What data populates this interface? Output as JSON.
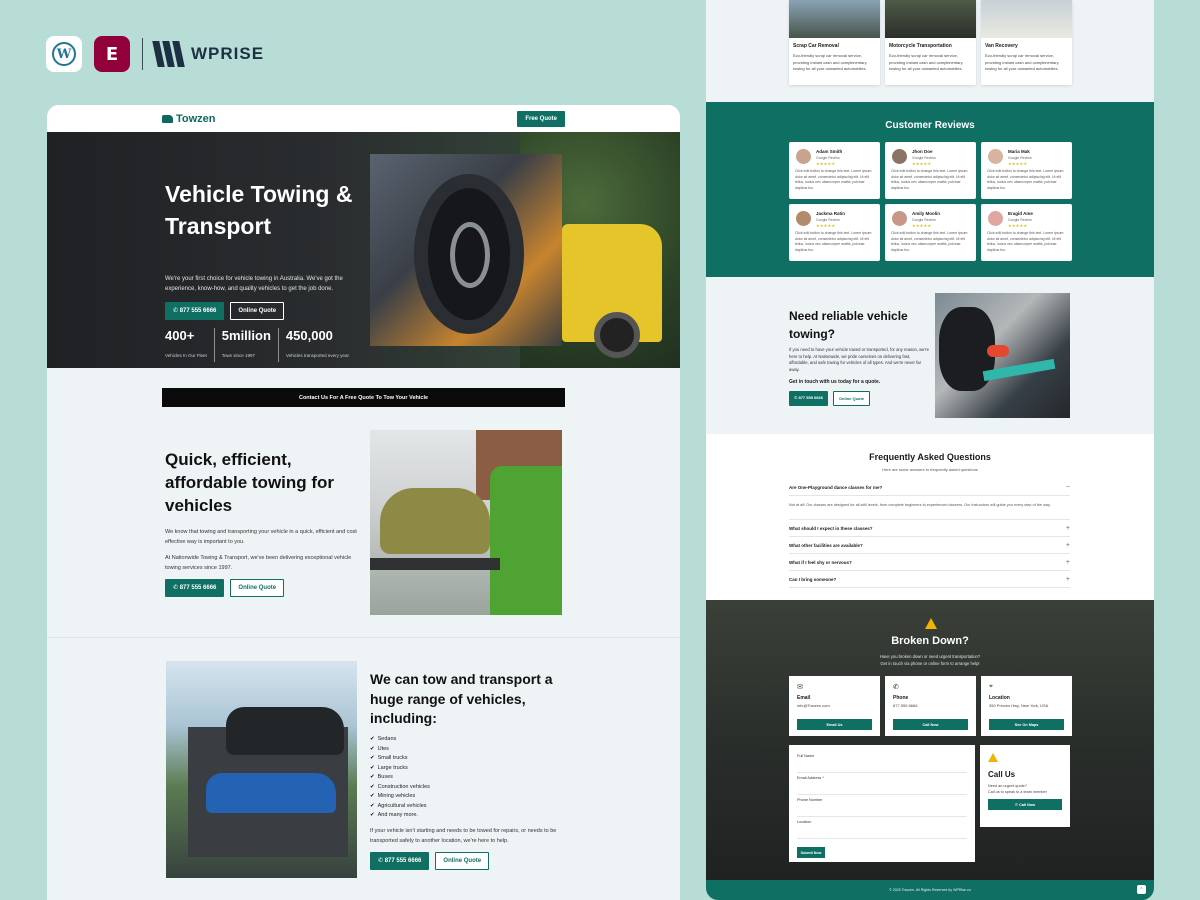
{
  "brand": {
    "wordpress": "W",
    "elementor": "E",
    "wprise": "WPRISE"
  },
  "site": {
    "logo": "Towzen",
    "nav_cta": "Free Quote"
  },
  "hero": {
    "title": "Vehicle Towing & Transport",
    "text": "We're your first choice for vehicle towing in Australia. We've got the experience, know-how, and quality vehicles to get the job done.",
    "phone": "✆ 877 555 6666",
    "quote": "Online Quote",
    "stats": [
      {
        "value": "400+",
        "label": "Vehicles In Our Fleet"
      },
      {
        "value": "5million",
        "label": "Tows since 1997"
      },
      {
        "value": "450,000",
        "label": "Vehicles transported every year"
      }
    ]
  },
  "cta_bar": "Contact Us For A Free Quote To Tow Your Vehicle",
  "section2": {
    "title": "Quick, efficient, affordable towing for vehicles",
    "p1": "We know that towing and transporting your vehicle in a quick, efficient and cost effective way is important to you.",
    "p2": "At Nationwide Towing & Transport, we've been delivering exceptional vehicle towing services since 1997.",
    "phone": "✆ 877 555 6666",
    "quote": "Online Quote"
  },
  "section3": {
    "title": "We can tow and transport a huge range of vehicles, including:",
    "items": [
      "Sedans",
      "Utes",
      "Small trucks",
      "Large trucks",
      "Buses",
      "Construction vehicles",
      "Mining vehicles",
      "Agricultural vehicles",
      "And many more."
    ],
    "text": "If your vehicle isn't starting and needs to be towed for repairs, or needs to be transported safely to another location, we're here to help.",
    "phone": "✆ 877 555 6666",
    "quote": "Online Quote"
  },
  "services": [
    {
      "title": "Scrap Car Removal",
      "text": "Eco-friendly scrap car removal service, providing instant cash and complimentary towing for all your unwanted automobiles."
    },
    {
      "title": "Motorcycle Transportation",
      "text": "Eco-friendly scrap car removal service, providing instant cash and complimentary towing for all your unwanted automobiles."
    },
    {
      "title": "Van Recovery",
      "text": "Eco-friendly scrap car removal service, providing instant cash and complimentary towing for all your unwanted automobiles."
    }
  ],
  "reviews": {
    "title": "Customer Reviews",
    "stars": "★★★★★",
    "source": "Google Review",
    "text": "Click edit button to change this text. Lorem ipsum dolor sit amet, consectetur adipiscing elit. Ut elit tellus, luctus nec ullamcorper mattis, pulvinar dapibus leo.",
    "names": [
      "Adam Smith",
      "Jhon Doe",
      "Maria Mak",
      "Jackma Ratin",
      "Amily Moolin",
      "Eragid Ame"
    ]
  },
  "need": {
    "title": "Need reliable vehicle towing?",
    "text": "If you need to have your vehicle towed or transported, for any reason, we're here to help. At Nationwide, we pride ourselves on delivering fast, affordable, and safe towing for vehicles of all types. And we're never far away.",
    "bold": "Get in touch with us today for a quote.",
    "phone": "✆ 877 555 6666",
    "quote": "Online Quote"
  },
  "faq": {
    "title": "Frequently Asked Questions",
    "sub": "Here are some answers to frequently asked questions",
    "q1": "Are One-Playground dance classes for me?",
    "a1": "Not at all! Our classes are designed for all skill levels, from complete beginners to experienced dancers. Our instructors will guide you every step of the way.",
    "rest": [
      "What should I expect in these classes?",
      "What other facilities are available?",
      "What if I feel shy or nervous?",
      "Can I bring someone?"
    ],
    "minus": "−",
    "plus": "+"
  },
  "broken": {
    "title": "Broken Down?",
    "sub1": "Have you broken down or need urgent transportation?",
    "sub2": "Get in touch via phone or online form to arrange help!",
    "cards": [
      {
        "icon": "✉",
        "title": "Email",
        "value": "info@Towzen.com",
        "button": "Email Us"
      },
      {
        "icon": "✆",
        "title": "Phone",
        "value": "877 555 6666",
        "button": "Call Now"
      },
      {
        "icon": "⌖",
        "title": "Location",
        "value": "350 Princes Hwy, New York, USA",
        "button": "See On Maps"
      }
    ],
    "form": {
      "fields": [
        "Full Name",
        "Email Address *",
        "Phone Number",
        "Location"
      ],
      "submit": "Submit Now"
    },
    "call": {
      "title": "Call Us",
      "line1": "Need an urgent quote?",
      "line2": "Call us to speak to a team member",
      "button": "✆ Call Now"
    }
  },
  "footer": {
    "text": "© 2025 Towzen. All Rights Reserved by WPRise.co",
    "up": "⌃"
  }
}
